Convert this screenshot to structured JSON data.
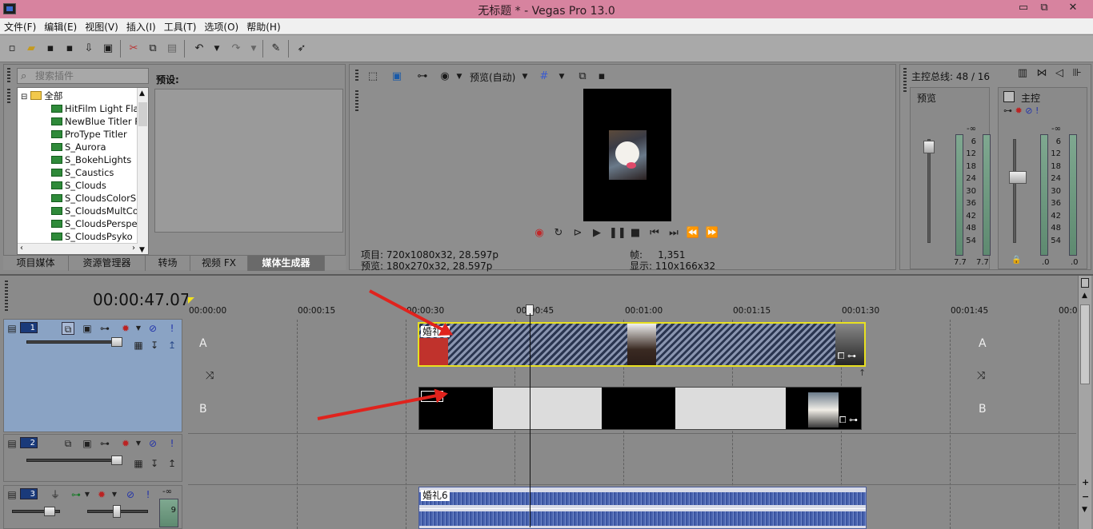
{
  "window": {
    "title": "无标题 * - Vegas Pro 13.0",
    "minimize": "▭",
    "restore": "⧉",
    "close": "✕"
  },
  "menu": [
    "文件(F)",
    "编辑(E)",
    "视图(V)",
    "插入(I)",
    "工具(T)",
    "选项(O)",
    "帮助(H)"
  ],
  "plugins": {
    "search_placeholder": "搜索插件",
    "root": "全部",
    "items": [
      "HitFilm Light Fla",
      "NewBlue Titler P",
      "ProType Titler",
      "S_Aurora",
      "S_BokehLights",
      "S_Caustics",
      "S_Clouds",
      "S_CloudsColorS",
      "S_CloudsMultCo",
      "S_CloudsPerspe",
      "S_CloudsPsyko"
    ],
    "preset_label": "预设:"
  },
  "tabs": [
    "项目媒体",
    "资源管理器",
    "转场",
    "视频 FX",
    "媒体生成器"
  ],
  "active_tab": "媒体生成器",
  "preview": {
    "mode": "预览(自动)",
    "project_label": "项目:",
    "project_value": "720x1080x32, 28.597p",
    "preview_label": "预览:",
    "preview_value": "180x270x32, 28.597p",
    "frame_label": "帧:",
    "frame_value": "1,351",
    "display_label": "显示:",
    "display_value": "110x166x32"
  },
  "master": {
    "title": "主控总线: 48 / 16",
    "preview_label": "预览",
    "master_label": "主控",
    "scale": [
      "-∞",
      "6",
      "12",
      "18",
      "24",
      "30",
      "36",
      "42",
      "48",
      "54"
    ],
    "preview_vals": [
      "7.7",
      "7.7"
    ],
    "master_vals": [
      ".0",
      ".0"
    ]
  },
  "timeline": {
    "timecode": "00:00:47.07",
    "ruler": [
      "00:00:00",
      "00:00:15",
      "00:00:30",
      "00:00:45",
      "00:01:00",
      "00:01:15",
      "00:01:30",
      "00:01:45",
      "00:0"
    ],
    "tracks": [
      {
        "num": "1",
        "side_a": "A",
        "side_a2": "A",
        "clip": "婚礼6"
      },
      {
        "num": "2",
        "side_b": "B",
        "side_b2": "B"
      },
      {
        "num": "3",
        "clip": "婚礼6",
        "vol": "-∞",
        "meter_val": "9"
      }
    ]
  }
}
